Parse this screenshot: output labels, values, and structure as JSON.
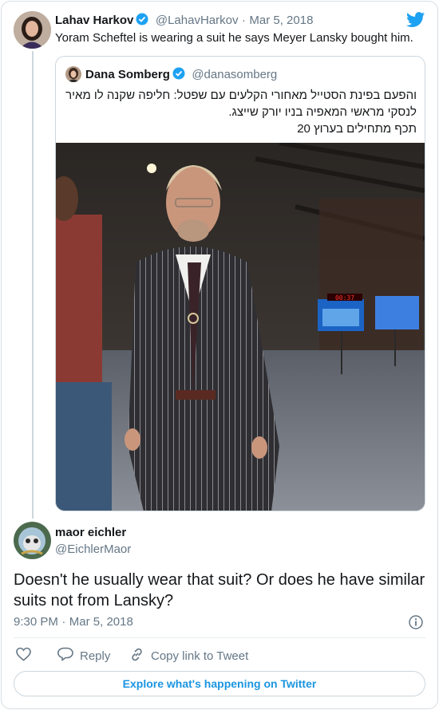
{
  "tweet": {
    "author_name": "Lahav Harkov",
    "handle": "@LahavHarkov",
    "separator": "·",
    "date": "Mar 5, 2018",
    "text": "Yoram Scheftel is wearing a suit he says Meyer Lansky bought him."
  },
  "quoted": {
    "author_name": "Dana Somberg",
    "handle": "@danasomberg",
    "text_line1": "והפעם בפינת הסטייל מאחורי הקלעים עם שפטל: חליפה שקנה לו מאיר",
    "text_line2": "לנסקי מראשי המאפיה בניו יורק שייצג.",
    "text_line3": "תכף מתחילים בערוץ 20",
    "photo_screen_clock": "00:37"
  },
  "reply": {
    "author_name": "maor eichler",
    "handle": "@EichlerMaor",
    "text": "Doesn't he usually wear that suit? Or does he have similar suits not from Lansky?",
    "time": "9:30 PM",
    "separator": "·",
    "date": "Mar 5, 2018"
  },
  "actions": {
    "reply_label": "Reply",
    "copy_link_label": "Copy link to Tweet"
  },
  "footer": {
    "explore_label": "Explore what's happening on Twitter"
  },
  "colors": {
    "brand": "#1da1f2",
    "link": "#1b95e0",
    "muted": "#657786",
    "border": "#ccd6dd"
  },
  "icons": [
    "twitter-bird-icon",
    "verified-badge-icon",
    "info-icon",
    "heart-icon",
    "reply-bubble-icon",
    "link-icon"
  ]
}
